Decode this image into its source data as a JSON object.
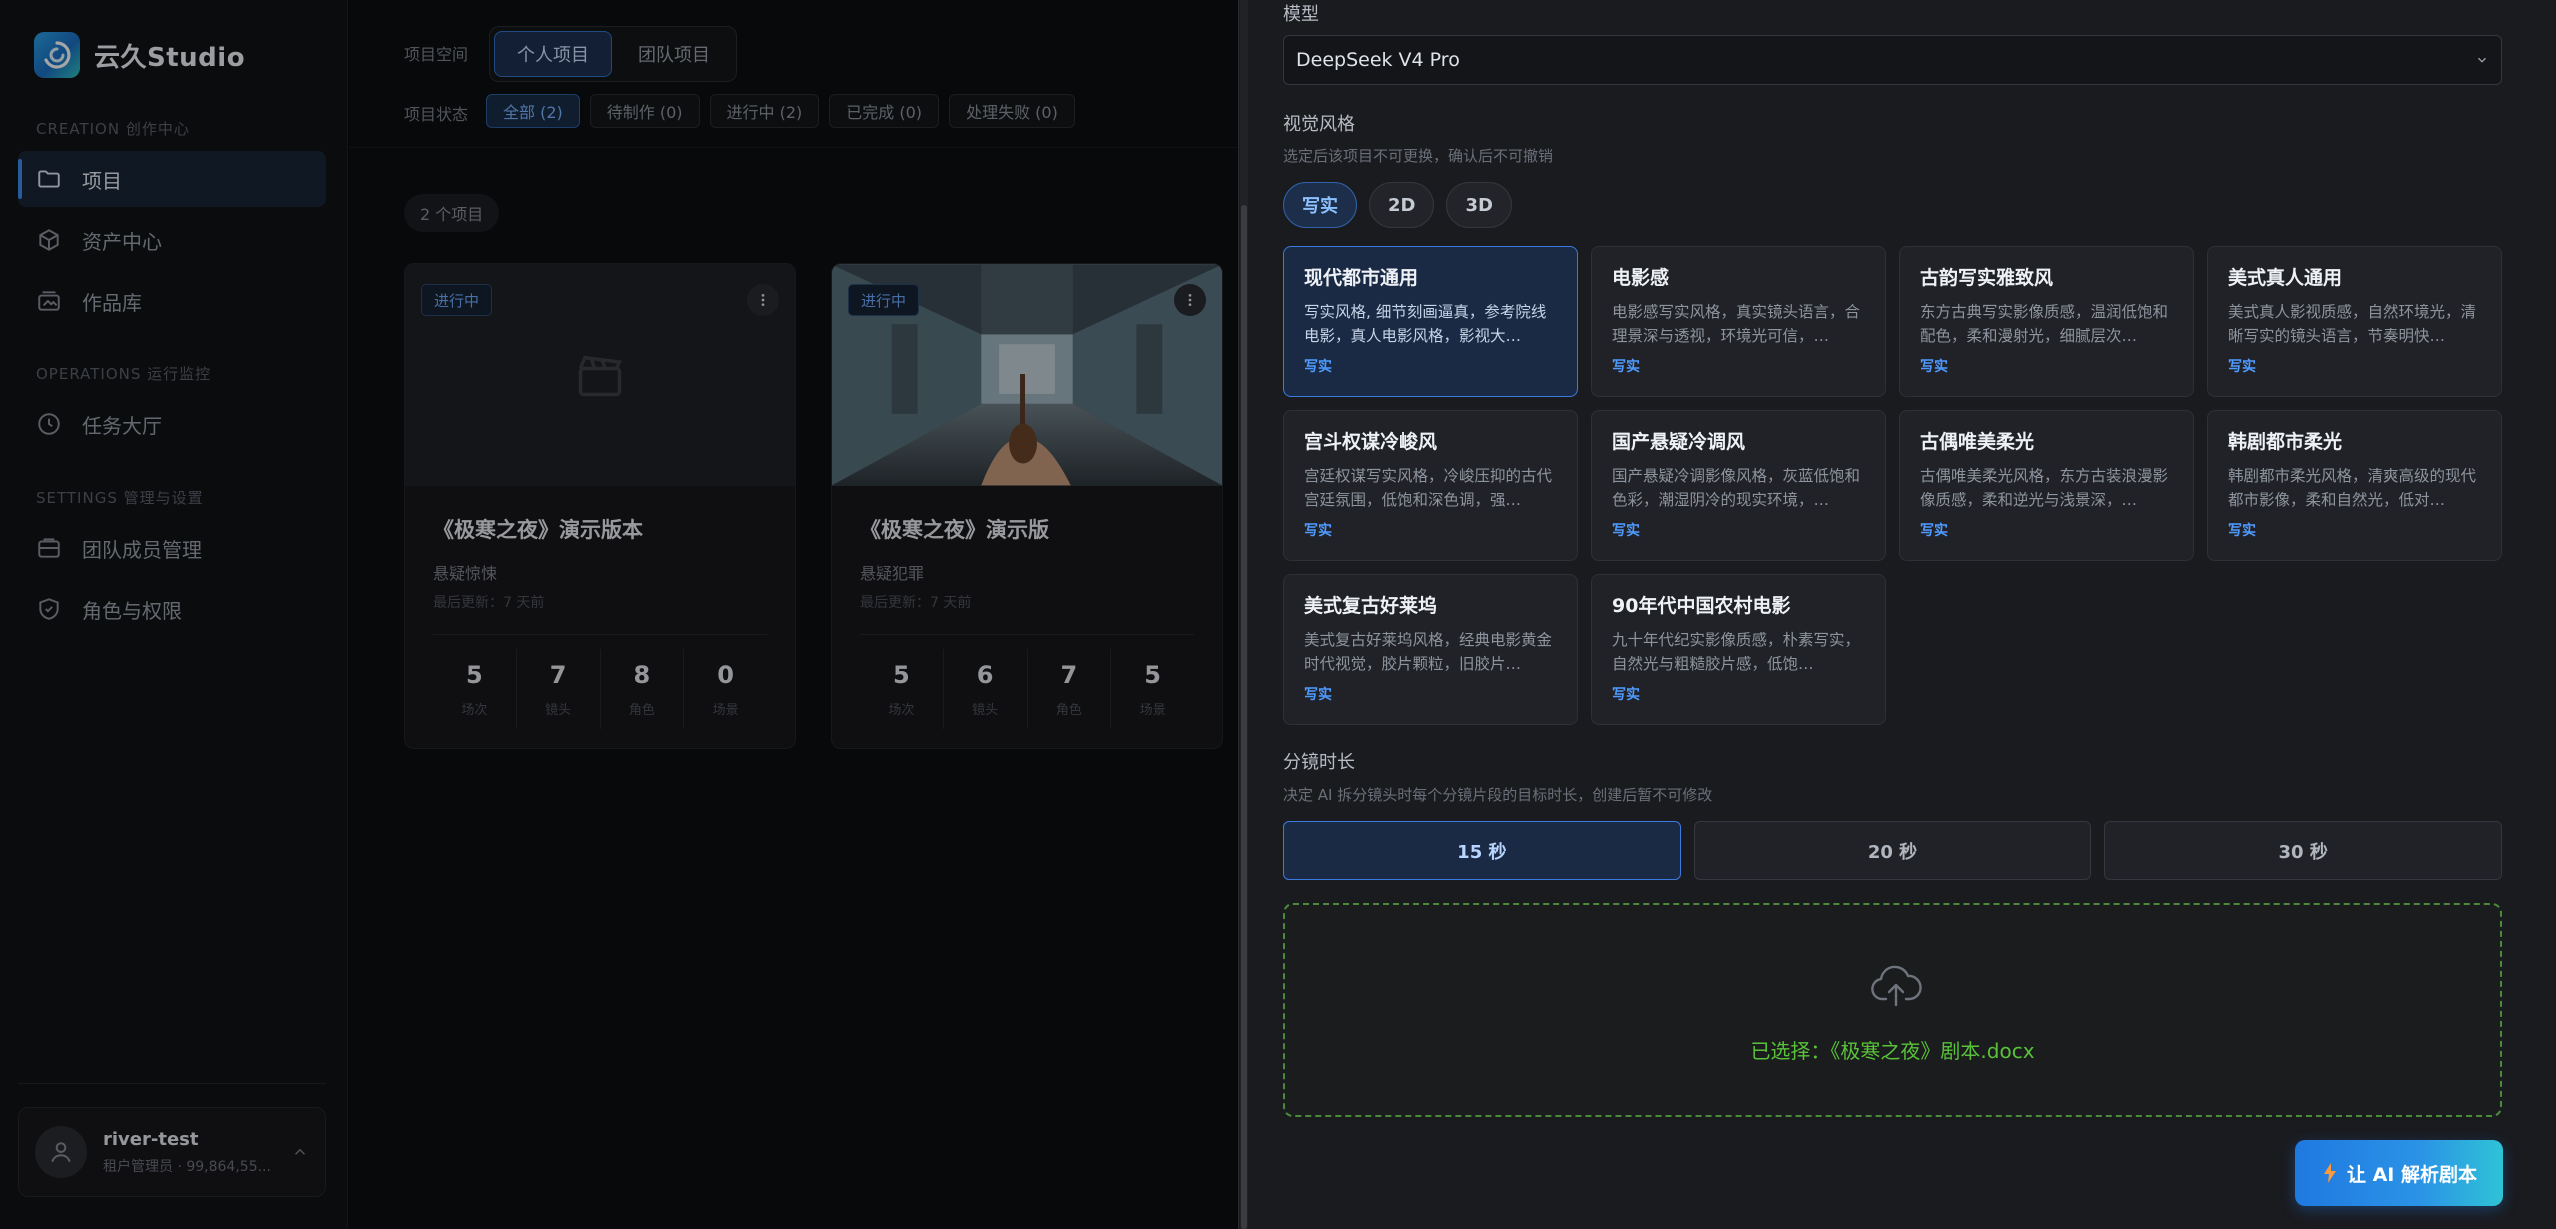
{
  "brand": {
    "name": "云久Studio"
  },
  "sidebar": {
    "sections": [
      "CREATION 创作中心",
      "OPERATIONS 运行监控",
      "SETTINGS 管理与设置"
    ],
    "items": [
      {
        "label": "项目",
        "icon": "folder-icon"
      },
      {
        "label": "资产中心",
        "icon": "box-icon"
      },
      {
        "label": "作品库",
        "icon": "image-stack-icon"
      },
      {
        "label": "任务大厅",
        "icon": "clock-icon"
      },
      {
        "label": "团队成员管理",
        "icon": "users-icon"
      },
      {
        "label": "角色与权限",
        "icon": "shield-icon"
      }
    ],
    "user": {
      "name": "river-test",
      "role": "租户管理员 · 99,864,55..."
    }
  },
  "toolbar": {
    "space_label": "项目空间",
    "space_tabs": [
      "个人项目",
      "团队项目"
    ],
    "status_label": "项目状态",
    "status_chips": [
      "全部 (2)",
      "待制作 (0)",
      "进行中 (2)",
      "已完成 (0)",
      "处理失败 (0)"
    ]
  },
  "count_label": "2 个项目",
  "projects": [
    {
      "status": "进行中",
      "title": "《极寒之夜》演示版本",
      "genre": "悬疑惊悚",
      "updated": "最后更新：7 天前",
      "stats": [
        {
          "value": "5",
          "label": "场次"
        },
        {
          "value": "7",
          "label": "镜头"
        },
        {
          "value": "8",
          "label": "角色"
        },
        {
          "value": "0",
          "label": "场景"
        }
      ]
    },
    {
      "status": "进行中",
      "title": "《极寒之夜》演示版",
      "genre": "悬疑犯罪",
      "updated": "最后更新：7 天前",
      "stats": [
        {
          "value": "5",
          "label": "场次"
        },
        {
          "value": "6",
          "label": "镜头"
        },
        {
          "value": "7",
          "label": "角色"
        },
        {
          "value": "5",
          "label": "场景"
        }
      ]
    }
  ],
  "panel": {
    "model_label": "模型",
    "model_value": "DeepSeek V4 Pro",
    "style_label": "视觉风格",
    "style_hint": "选定后该项目不可更换，确认后不可撤销",
    "style_tabs": [
      "写实",
      "2D",
      "3D"
    ],
    "styles": [
      {
        "title": "现代都市通用",
        "desc": "写实风格, 细节刻画逼真，参考院线电影，真人电影风格，影视大…",
        "tag": "写实"
      },
      {
        "title": "电影感",
        "desc": "电影感写实风格，真实镜头语言，合理景深与透视，环境光可信，…",
        "tag": "写实"
      },
      {
        "title": "古韵写实雅致风",
        "desc": "东方古典写实影像质感，温润低饱和配色，柔和漫射光，细腻层次…",
        "tag": "写实"
      },
      {
        "title": "美式真人通用",
        "desc": "美式真人影视质感，自然环境光，清晰写实的镜头语言，节奏明快…",
        "tag": "写实"
      },
      {
        "title": "宫斗权谋冷峻风",
        "desc": "宫廷权谋写实风格，冷峻压抑的古代宫廷氛围，低饱和深色调，强…",
        "tag": "写实"
      },
      {
        "title": "国产悬疑冷调风",
        "desc": "国产悬疑冷调影像风格，灰蓝低饱和色彩，潮湿阴冷的现实环境，…",
        "tag": "写实"
      },
      {
        "title": "古偶唯美柔光",
        "desc": "古偶唯美柔光风格，东方古装浪漫影像质感，柔和逆光与浅景深，…",
        "tag": "写实"
      },
      {
        "title": "韩剧都市柔光",
        "desc": "韩剧都市柔光风格，清爽高级的现代都市影像，柔和自然光，低对…",
        "tag": "写实"
      },
      {
        "title": "美式复古好莱坞",
        "desc": "美式复古好莱坞风格，经典电影黄金时代视觉，胶片颗粒，旧胶片…",
        "tag": "写实"
      },
      {
        "title": "90年代中国农村电影",
        "desc": "九十年代纪实影像质感，朴素写实，自然光与粗糙胶片感，低饱…",
        "tag": "写实"
      }
    ],
    "duration_label": "分镜时长",
    "duration_hint": "决定 AI 拆分镜头时每个分镜片段的目标时长，创建后暂不可修改",
    "durations": [
      "15 秒",
      "20 秒",
      "30 秒"
    ],
    "upload_text": "已选择：《极寒之夜》剧本.docx",
    "cta_label": "让 AI 解析剧本"
  },
  "colors": {
    "accent": "#3b7be0",
    "success": "#59c23a",
    "cta_start": "#1f79e0",
    "cta_end": "#2fc3d6"
  }
}
